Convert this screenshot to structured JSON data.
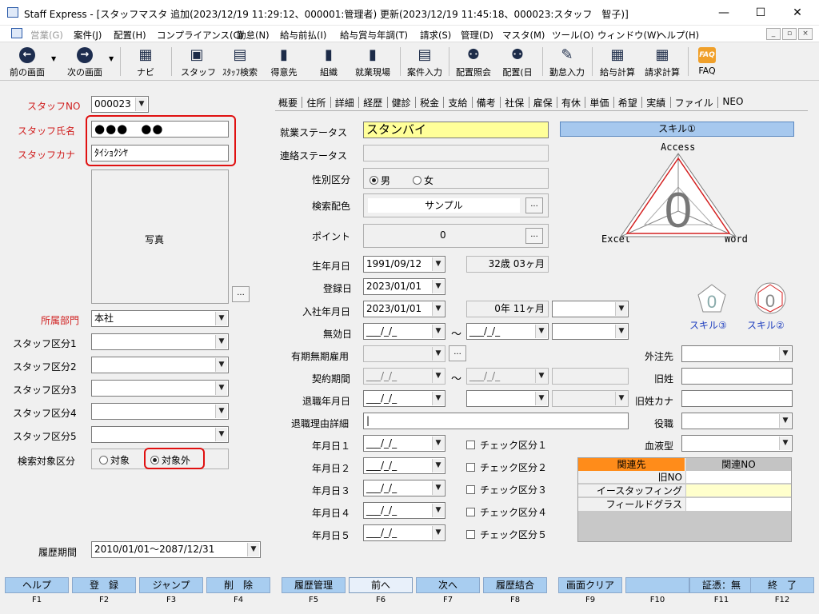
{
  "window": {
    "title": "Staff Express - [スタッフマスタ 追加(2023/12/19 11:29:12、000001:管理者) 更新(2023/12/19 11:45:18、000023:スタッフ　智子)]",
    "minimize": "—",
    "maximize": "☐",
    "close": "✕"
  },
  "menu": [
    {
      "label": "営業(G)",
      "disabled": true
    },
    {
      "label": "案件(J)"
    },
    {
      "label": "配置(H)"
    },
    {
      "label": "コンプライアンス(C)"
    },
    {
      "label": "勤怠(N)"
    },
    {
      "label": "給与前払(I)"
    },
    {
      "label": "給与賞与年調(T)"
    },
    {
      "label": "請求(S)"
    },
    {
      "label": "管理(D)"
    },
    {
      "label": "マスタ(M)"
    },
    {
      "label": "ツール(O)"
    },
    {
      "label": "ウィンドウ(W)"
    },
    {
      "label": "ヘルプ(H)"
    }
  ],
  "toolbar": [
    {
      "label": "前の画面",
      "icon": "back-arrow-icon"
    },
    {
      "label": "次の画面",
      "icon": "forward-arrow-icon"
    },
    {
      "label": "ナビ",
      "icon": "navi-icon"
    },
    {
      "label": "スタッフ",
      "icon": "staff-icon"
    },
    {
      "label": "ｽﾀｯﾌ検索",
      "icon": "staff-search-icon"
    },
    {
      "label": "得意先",
      "icon": "customer-icon"
    },
    {
      "label": "組織",
      "icon": "organization-icon"
    },
    {
      "label": "就業現場",
      "icon": "worksite-icon"
    },
    {
      "label": "案件入力",
      "icon": "case-entry-icon"
    },
    {
      "label": "配置照会",
      "icon": "placement-inquiry-icon"
    },
    {
      "label": "配置(日",
      "icon": "placement-daily-icon"
    },
    {
      "label": "勤怠入力",
      "icon": "attendance-entry-icon"
    },
    {
      "label": "給与計算",
      "icon": "payroll-icon"
    },
    {
      "label": "請求計算",
      "icon": "billing-icon"
    },
    {
      "label": "FAQ",
      "icon": "faq-icon"
    }
  ],
  "left": {
    "staff_no_label": "スタッフNO",
    "staff_no": "000023",
    "name_label": "スタッフ氏名",
    "name_value": "●●●　●●",
    "kana_label": "スタッフカナ",
    "kana_value": "ﾀｲｼｮｸｼﾔ",
    "photo_label": "写真",
    "photo_button": "...",
    "dept_label": "所属部門",
    "dept_value": "本社",
    "categories": [
      "スタッフ区分1",
      "スタッフ区分2",
      "スタッフ区分3",
      "スタッフ区分4",
      "スタッフ区分5"
    ],
    "search_target_label": "検索対象区分",
    "search_target_options": [
      "対象",
      "対象外"
    ],
    "search_target_selected": "対象外",
    "history_label": "履歴期間",
    "history_value": "2010/01/01〜2087/12/31"
  },
  "tabs": [
    "概要",
    "住所",
    "詳細",
    "経歴",
    "健診",
    "税金",
    "支給",
    "備考",
    "社保",
    "雇保",
    "有休",
    "単価",
    "希望",
    "実績",
    "ファイル",
    "NEO"
  ],
  "main": {
    "work_status_label": "就業ステータス",
    "work_status": "スタンバイ",
    "contact_status_label": "連絡ステータス",
    "gender_label": "性別区分",
    "gender_options": [
      "男",
      "女"
    ],
    "gender_selected": "男",
    "search_color_label": "検索配色",
    "search_color": "サンプル",
    "points_label": "ポイント",
    "points": "0",
    "dots": "...",
    "birth_label": "生年月日",
    "birth": "1991/09/12",
    "age": "32歳 03ヶ月",
    "reg_label": "登録日",
    "reg": "2023/01/01",
    "join_label": "入社年月日",
    "join": "2023/01/01",
    "tenure": "0年 11ヶ月",
    "invalid_label": "無効日",
    "date_blank": "___/_/_",
    "tilde": "〜",
    "term_label": "有期無期雇用",
    "contract_label": "契約期間",
    "retire_label": "退職年月日",
    "retire_reason_label": "退職理由詳細",
    "ymd_labels": [
      "年月日１",
      "年月日２",
      "年月日３",
      "年月日４",
      "年月日５"
    ],
    "check_labels": [
      "チェック区分１",
      "チェック区分２",
      "チェック区分３",
      "チェック区分４",
      "チェック区分５"
    ],
    "outsource_label": "外注先",
    "old_name_label": "旧姓",
    "old_kana_label": "旧姓カナ",
    "position_label": "役職",
    "blood_label": "血液型"
  },
  "skill": {
    "header": "スキル①",
    "top": "Access",
    "left": "Excel",
    "right": "Word",
    "score": "0",
    "skill3": "スキル③",
    "skill2": "スキル②"
  },
  "related": {
    "headers": [
      "関連先",
      "関連NO"
    ],
    "rows": [
      {
        "name": "旧NO",
        "no": ""
      },
      {
        "name": "イースタッフィング",
        "no": ""
      },
      {
        "name": "フィールドグラス",
        "no": ""
      }
    ]
  },
  "fkeys": [
    {
      "label": "ヘルプ",
      "key": "F1"
    },
    {
      "label": "登　録",
      "key": "F2"
    },
    {
      "label": "ジャンプ",
      "key": "F3"
    },
    {
      "label": "削　除",
      "key": "F4"
    },
    {
      "label": "履歴管理",
      "key": "F5"
    },
    {
      "label": "前へ",
      "key": "F6"
    },
    {
      "label": "次へ",
      "key": "F7"
    },
    {
      "label": "履歴結合",
      "key": "F8"
    },
    {
      "label": "画面クリア",
      "key": "F9"
    },
    {
      "label": "",
      "key": "F10"
    },
    {
      "label": "証憑：無",
      "key": "F11"
    },
    {
      "label": "終　了",
      "key": "F12"
    }
  ],
  "colors": {
    "accent_red": "#e01010",
    "status_yellow": "#ffff99",
    "skill_header": "#a6c8ee",
    "related_header_orange": "#ff8c1a",
    "fkey_blue": "#a8cdf0"
  }
}
